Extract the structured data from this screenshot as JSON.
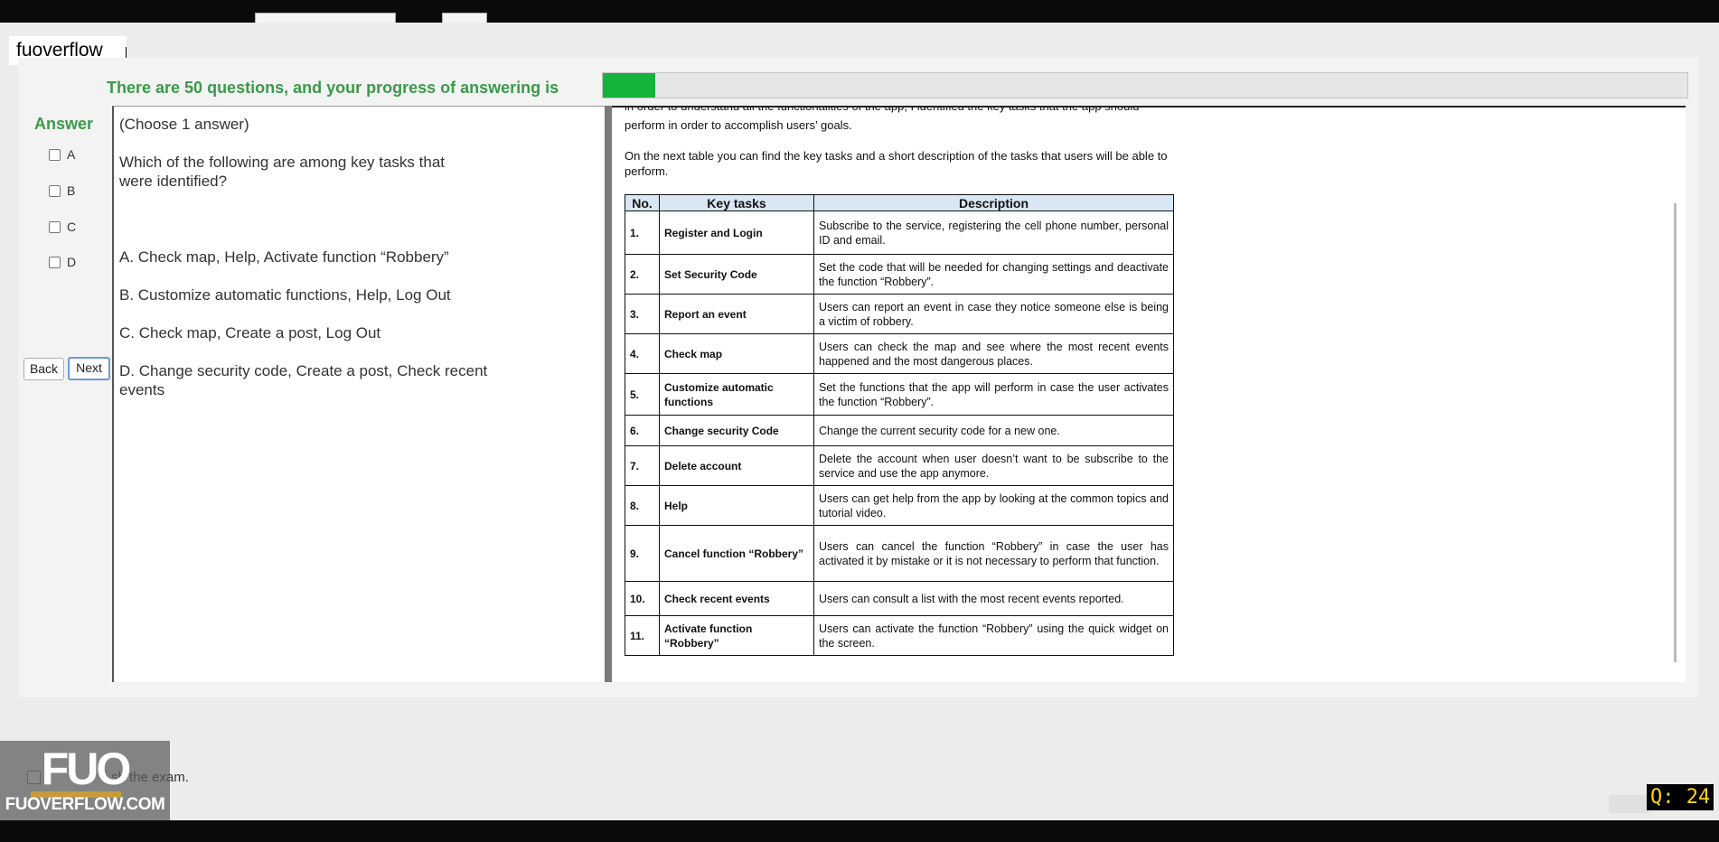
{
  "site_label": "fuoverflow",
  "progress": {
    "label": "There are 50 questions, and your progress of answering is",
    "fraction": 0.048,
    "fill_color": "#14b43a"
  },
  "answer": {
    "title": "Answer",
    "options": [
      "A",
      "B",
      "C",
      "D"
    ]
  },
  "nav": {
    "back": "Back",
    "next": "Next"
  },
  "question": {
    "choose": "(Choose 1 answer)",
    "text": "Which of the following are among key tasks that were identified?",
    "answers": [
      "A.  Check map, Help, Activate function “Robbery”",
      "B.  Customize automatic functions, Help, Log Out",
      "C.  Check map, Create a post, Log Out",
      "D.  Change security code, Create a post, Check recent events"
    ]
  },
  "document": {
    "cut_line": "in order to understand all the functionalities of the app, I identified the key tasks that the app should",
    "line1": "perform in order to accomplish users’ goals.",
    "line2": "On the next table you can find the key tasks and a short description of the tasks that users will be able to perform.",
    "table": {
      "headers": [
        "No.",
        "Key tasks",
        "Description"
      ],
      "rows": [
        {
          "no": "1.",
          "task": "Register and Login",
          "desc": "Subscribe to the service, registering the cell phone number, personal ID and email."
        },
        {
          "no": "2.",
          "task": "Set Security Code",
          "desc": "Set the code that will be needed for changing settings and deactivate the function “Robbery”."
        },
        {
          "no": "3.",
          "task": "Report an event",
          "desc": "Users can report an event in case they notice someone else is being a victim of robbery."
        },
        {
          "no": "4.",
          "task": "Check map",
          "desc": "Users can check the map and see where the most recent events happened and the most dangerous places."
        },
        {
          "no": "5.",
          "task": "Customize automatic functions",
          "desc": "Set the functions that the app will perform in case the user activates the function “Robbery”."
        },
        {
          "no": "6.",
          "task": "Change security Code",
          "desc": "Change the current security code for a new one."
        },
        {
          "no": "7.",
          "task": "Delete account",
          "desc": "Delete the account when user doesn’t want to be subscribe to the service and use the app anymore."
        },
        {
          "no": "8.",
          "task": "Help",
          "desc": "Users can get help from the app by looking at the common topics and tutorial video."
        },
        {
          "no": "9.",
          "task": "Cancel function “Robbery”",
          "desc": "Users can cancel the function “Robbery” in case the user has activated it by mistake or it is not necessary to perform that function."
        },
        {
          "no": "10.",
          "task": "Check recent events",
          "desc": "Users can consult a list with the most recent events reported."
        },
        {
          "no": "11.",
          "task": "Activate function “Robbery”",
          "desc": "Users can activate the function “Robbery” using the quick widget on the screen."
        }
      ]
    }
  },
  "finish_label": "sh the exam.",
  "logo": {
    "big": "FUO",
    "site": "FUOVERFLOW.COM"
  },
  "question_counter": "Q: 24"
}
